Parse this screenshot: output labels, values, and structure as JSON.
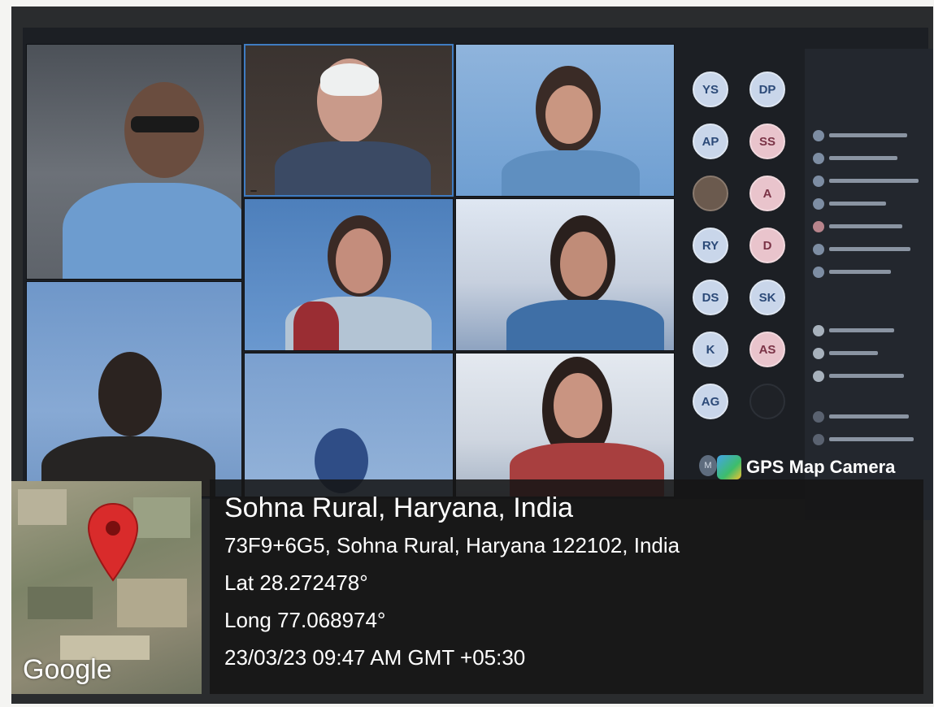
{
  "location": {
    "title": "Sohna Rural, Haryana, India",
    "address": "73F9+6G5, Sohna Rural, Haryana 122102, India",
    "lat": "Lat 28.272478°",
    "long": "Long 77.068974°",
    "datetime": "23/03/23 09:47 AM GMT +05:30"
  },
  "stamp": {
    "app_name": "GPS Map Camera",
    "map_brand": "Google"
  },
  "meeting": {
    "avatars": [
      {
        "initials": "YS"
      },
      {
        "initials": "DP"
      },
      {
        "initials": "AP"
      },
      {
        "initials": "SS"
      },
      {
        "initials": ""
      },
      {
        "initials": "A"
      },
      {
        "initials": "RY"
      },
      {
        "initials": "D"
      },
      {
        "initials": "DS"
      },
      {
        "initials": "SK"
      },
      {
        "initials": "K"
      },
      {
        "initials": "AS"
      },
      {
        "initials": "AG"
      },
      {
        "initials": ""
      }
    ],
    "chip_initials": "M"
  },
  "colors": {
    "overlay": "#161616",
    "pin": "#d92b2b",
    "avatar": "#c9d6ea"
  }
}
